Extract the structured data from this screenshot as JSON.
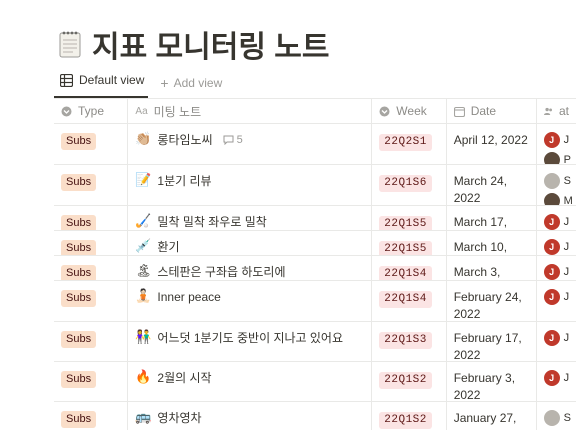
{
  "page": {
    "title": "지표 모니터링 노트",
    "icon": "notepad-icon"
  },
  "views": {
    "active_label": "Default view",
    "add_label": "Add view"
  },
  "columns": {
    "type": "Type",
    "name": "미팅 노트",
    "week": "Week",
    "date": "Date",
    "attendees": "at"
  },
  "colors": {
    "subs_tag_bg": "#fadec9",
    "week_tag_bg": "#fbe4e4",
    "avatar_red": "#c0392b"
  },
  "rows": [
    {
      "type": "Subs",
      "emoji": "👏🏼",
      "name": "롱타임노씨",
      "comments": "5",
      "week": "22Q2S1",
      "date": "April 12, 2022",
      "attendees": [
        {
          "initial": "J",
          "name": "J"
        },
        {
          "initial": "",
          "name": "P"
        }
      ]
    },
    {
      "type": "Subs",
      "emoji": "📝",
      "name": "1분기 리뷰",
      "comments": "",
      "week": "22Q1S6",
      "date": "March 24, 2022",
      "attendees": [
        {
          "initial": "",
          "name": "S"
        },
        {
          "initial": "",
          "name": "M"
        }
      ]
    },
    {
      "type": "Subs",
      "emoji": "🏑",
      "name": "밀착 밀착 좌우로 밀착",
      "comments": "",
      "week": "22Q1S5",
      "date": "March 17, 2022",
      "attendees": [
        {
          "initial": "J",
          "name": "J"
        }
      ]
    },
    {
      "type": "Subs",
      "emoji": "💉",
      "name": "환기",
      "comments": "",
      "week": "22Q1S5",
      "date": "March 10, 2022",
      "attendees": [
        {
          "initial": "J",
          "name": "J"
        }
      ]
    },
    {
      "type": "Subs",
      "emoji": "🏝",
      "name": "스테판은 구좌읍 하도리에",
      "comments": "",
      "week": "22Q1S4",
      "date": "March 3, 2022",
      "attendees": [
        {
          "initial": "J",
          "name": "J"
        }
      ]
    },
    {
      "type": "Subs",
      "emoji": "🧘🏻",
      "name": "Inner peace",
      "comments": "",
      "week": "22Q1S4",
      "date": "February 24, 2022",
      "attendees": [
        {
          "initial": "J",
          "name": "J"
        }
      ]
    },
    {
      "type": "Subs",
      "emoji": "👫",
      "name": "어느덧 1분기도 중반이 지나고 있어요",
      "comments": "",
      "week": "22Q1S3",
      "date": "February 17, 2022",
      "attendees": [
        {
          "initial": "J",
          "name": "J"
        }
      ]
    },
    {
      "type": "Subs",
      "emoji": "🔥",
      "name": "2월의 시작",
      "comments": "",
      "week": "22Q1S2",
      "date": "February 3, 2022",
      "attendees": [
        {
          "initial": "J",
          "name": "J"
        }
      ]
    },
    {
      "type": "Subs",
      "emoji": "🚌",
      "name": "영차영차",
      "comments": "",
      "week": "22Q1S2",
      "date": "January 27, 2022",
      "attendees": [
        {
          "initial": "",
          "name": "S"
        }
      ]
    }
  ]
}
